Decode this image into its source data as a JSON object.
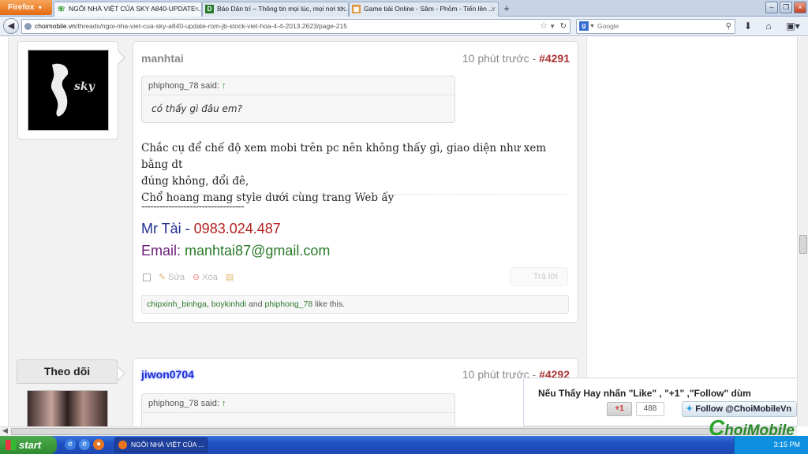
{
  "browser": {
    "menu_label": "Firefox",
    "tabs": [
      {
        "title": "NGÔI NHÀ VIỆT CỦA SKY A840-UPDATE ...",
        "icon": "phone-icon",
        "active": true
      },
      {
        "title": "Báo Dân trí – Thông tin mọi lúc, mọi nơi tớ...",
        "icon": "dantri-icon",
        "active": false
      },
      {
        "title": "Game bài Online - Sâm - Phỏm - Tiến lên ...",
        "icon": "game-icon",
        "active": false
      }
    ],
    "url_host": "choimobile.vn",
    "url_path": "/threads/ngoi-nha-viet-cua-sky-a840-update-rom-jb-stock-viet-hoa-4-4-2013.2623/page-215",
    "search_placeholder": "Google"
  },
  "posts": [
    {
      "username": "manhtai",
      "time": "10 phút trước",
      "separator": " - ",
      "number": "#4291",
      "quote_author": "phiphong_78 said:",
      "quote_arrow": "↑",
      "quote_text": "có thấy gì đâu em?",
      "message": [
        "Chắc cụ để chế độ xem mobi trên pc nên không thấy gì, giao diện như xem bằng dt",
        "đúng không, đổi đê,",
        "Chổ hoang mang style dưới cùng trang Web ấy"
      ],
      "sig_dash": "----------------------------------",
      "sig_name": "Mr Tài - ",
      "sig_phone": "0983.024.487",
      "sig_email_label": "Email: ",
      "sig_email": "manhtai87@gmail.com",
      "edit_label": "Sửa",
      "delete_label": "Xóa",
      "reply_label": "Trả lời",
      "likes_users": "chipxinh_binhga, boykinhdi",
      "likes_and": " and ",
      "likes_last": "phiphong_78",
      "likes_suffix": " like this."
    },
    {
      "username": "jiwon0704",
      "time": "10 phút trước",
      "separator": " - ",
      "number": "#4292",
      "quote_author": "phiphong_78 said:",
      "quote_arrow": "↑",
      "sidebar_label": "Theo dõi"
    }
  ],
  "promo": {
    "text": "Nếu Thấy Hay nhấn \"Like\" , \"+1\" ,\"Follow\" dùm",
    "gplus_label": "+1",
    "gplus_count": "488",
    "follow_label": "Follow @ChoiMobileVn"
  },
  "logo": {
    "c": "C",
    "text": "hoiMobile"
  },
  "taskbar": {
    "start_label": "start",
    "window_label": "NGÔI NHÀ VIỆT CỦA ...",
    "clock": "3:15 PM"
  },
  "colors": {
    "accent": "#a33333",
    "link_green": "#2e7a2e",
    "sig_blue": "#1f2f8f",
    "sig_red": "#b52222"
  }
}
